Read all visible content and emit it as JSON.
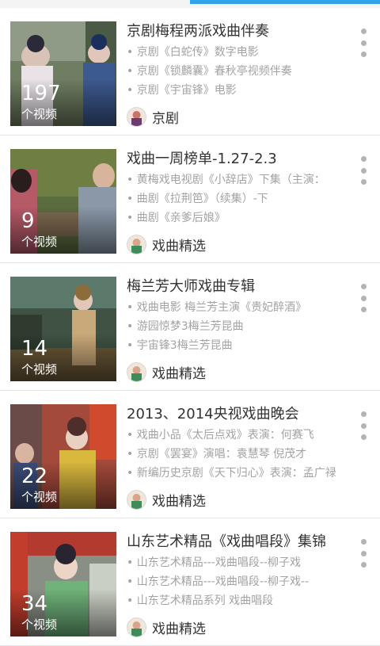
{
  "accent_color": "#2fa3e6",
  "cards": [
    {
      "title": "京剧梅程两派戏曲伴奏",
      "lines": [
        "• 京剧《白蛇传》数字电影",
        "• 京剧《锁麟囊》春秋亭视频伴奏",
        "• 京剧《宇宙锋》电影"
      ],
      "count": "197",
      "count_unit": "个视频",
      "author": "京剧",
      "menu_icon": "more-vertical-icon"
    },
    {
      "title": "戏曲一周榜单-1.27-2.3",
      "lines": [
        "• 黄梅戏电视剧《小辞店》下集（主演：",
        "• 曲剧《拉荆笆》（续集）-下",
        "• 曲剧《亲爹后娘》"
      ],
      "count": "9",
      "count_unit": "个视频",
      "author": "戏曲精选",
      "menu_icon": "more-vertical-icon"
    },
    {
      "title": "梅兰芳大师戏曲专辑",
      "lines": [
        "• 戏曲电影 梅兰芳主演《贵妃醉酒》",
        "• 游园惊梦3梅兰芳昆曲",
        "• 宇宙锋3梅兰芳昆曲"
      ],
      "count": "14",
      "count_unit": "个视频",
      "author": "戏曲精选",
      "menu_icon": "more-vertical-icon"
    },
    {
      "title": "2013、2014央视戏曲晚会",
      "lines": [
        "• 戏曲小品《太后点戏》表演：何赛飞",
        "• 京剧《罢宴》演唱：袁慧琴 倪茂才",
        "• 新编历史京剧《天下归心》表演：孟广禄"
      ],
      "count": "22",
      "count_unit": "个视频",
      "author": "戏曲精选",
      "menu_icon": "more-vertical-icon"
    },
    {
      "title": "山东艺术精品《戏曲唱段》集锦",
      "lines": [
        "• 山东艺术精品---戏曲唱段--柳子戏",
        "• 山东艺术精品---戏曲唱段--柳子戏--",
        "• 山东艺术精品系列 戏曲唱段"
      ],
      "count": "34",
      "count_unit": "个视频",
      "author": "戏曲精选",
      "menu_icon": "more-vertical-icon"
    }
  ]
}
